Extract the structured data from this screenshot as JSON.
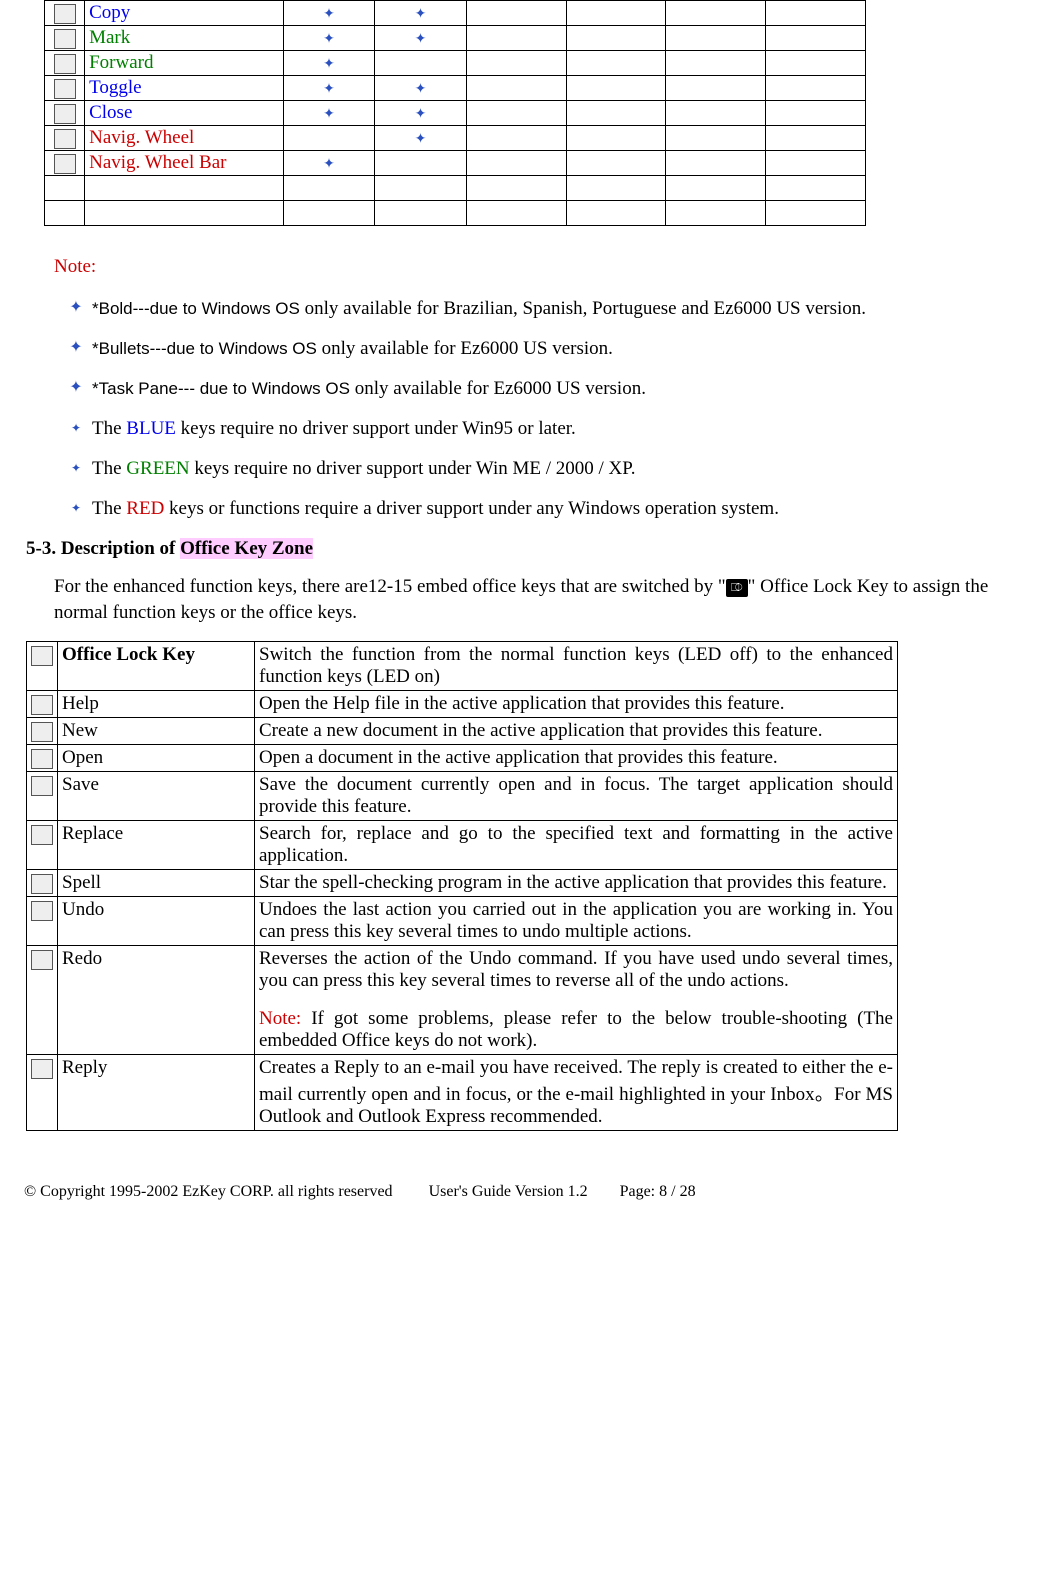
{
  "top_rows": [
    {
      "name": "Copy",
      "color": "blue",
      "marks": [
        true,
        true,
        false,
        false,
        false,
        false
      ]
    },
    {
      "name": "Mark",
      "color": "green",
      "marks": [
        true,
        true,
        false,
        false,
        false,
        false
      ]
    },
    {
      "name": "Forward",
      "color": "green",
      "marks": [
        true,
        false,
        false,
        false,
        false,
        false
      ]
    },
    {
      "name": "Toggle",
      "color": "blue",
      "marks": [
        true,
        true,
        false,
        false,
        false,
        false
      ]
    },
    {
      "name": "Close",
      "color": "blue",
      "marks": [
        true,
        true,
        false,
        false,
        false,
        false
      ]
    },
    {
      "name": "Navig. Wheel",
      "color": "red",
      "marks": [
        false,
        true,
        false,
        false,
        false,
        false
      ]
    },
    {
      "name": "Navig. Wheel Bar",
      "color": "red",
      "marks": [
        true,
        false,
        false,
        false,
        false,
        false
      ]
    },
    {
      "name": "",
      "color": "",
      "marks": [
        false,
        false,
        false,
        false,
        false,
        false
      ]
    },
    {
      "name": "",
      "color": "",
      "marks": [
        false,
        false,
        false,
        false,
        false,
        false
      ]
    }
  ],
  "note_heading": "Note:",
  "notes": [
    {
      "bullet": "large",
      "sans_prefix": "*Bold---due to Windows OS",
      "rest": " only available for Brazilian, Spanish, Portuguese and Ez6000 US version."
    },
    {
      "bullet": "large",
      "sans_prefix": "*Bullets---due to Windows OS",
      "rest": " only available for Ez6000 US version."
    },
    {
      "bullet": "large",
      "sans_prefix": "*Task Pane--- due to Windows OS",
      "rest": " only available for Ez6000 US version."
    },
    {
      "bullet": "small",
      "pre": "The ",
      "keyword": "BLUE",
      "key_color": "blue",
      "post": " keys require no driver support under Win95 or later."
    },
    {
      "bullet": "small",
      "pre": "The ",
      "keyword": "GREEN",
      "key_color": "green",
      "post": " keys require no driver support under Win ME / 2000 / XP."
    },
    {
      "bullet": "small",
      "pre": "The ",
      "keyword": "RED",
      "key_color": "red",
      "post": " keys or functions require a driver support under any Windows operation system."
    }
  ],
  "section_heading_pre": "5-3. Description of ",
  "section_heading_hl": "Office Key Zone",
  "para_pre": "For the enhanced function keys, there are12-15 embed office keys that are switched by \"",
  "para_post": "\" Office Lock Key to assign the normal function keys or the office keys.",
  "office_rows": [
    {
      "name": "Office Lock Key",
      "name_bold": true,
      "desc": "Switch the function from the normal function keys (LED off) to the enhanced function keys (LED on)"
    },
    {
      "name": "Help",
      "desc": "Open the Help file in the active application that provides this feature."
    },
    {
      "name": "New",
      "desc": "Create a new document in the active application that provides this feature."
    },
    {
      "name": "Open",
      "desc": "Open a document in the active application that provides this feature."
    },
    {
      "name": "Save",
      "desc": "Save the document currently open and in focus. The target application should provide this feature."
    },
    {
      "name": "Replace",
      "desc": "Search for, replace and go to the specified text and formatting in the active application."
    },
    {
      "name": "Spell",
      "desc": "Star the spell-checking program in the active application that provides this feature."
    },
    {
      "name": "Undo",
      "desc": "Undoes the last action you carried out in the application you are working in. You can press this key several times to undo multiple actions."
    },
    {
      "name": "Redo",
      "desc_pre": "Reverses the action of the Undo command. If you have used undo several times, you can press this key several times to reverse all of the undo actions.",
      "note_label": "Note:",
      "desc_post": " If got some problems, please refer to the below trouble-shooting (The embedded Office keys do not work)."
    },
    {
      "name": "Reply",
      "desc": "Creates a Reply to an e-mail you have received. The reply is created to either the e-mail currently open and in focus, or the e-mail highlighted in your Inbox。For MS Outlook and Outlook Express recommended."
    }
  ],
  "footer": {
    "left": "© Copyright 1995-2002 EzKey CORP. all rights reserved",
    "mid": "User's Guide Version 1.2",
    "right": "Page: 8 / 28"
  }
}
